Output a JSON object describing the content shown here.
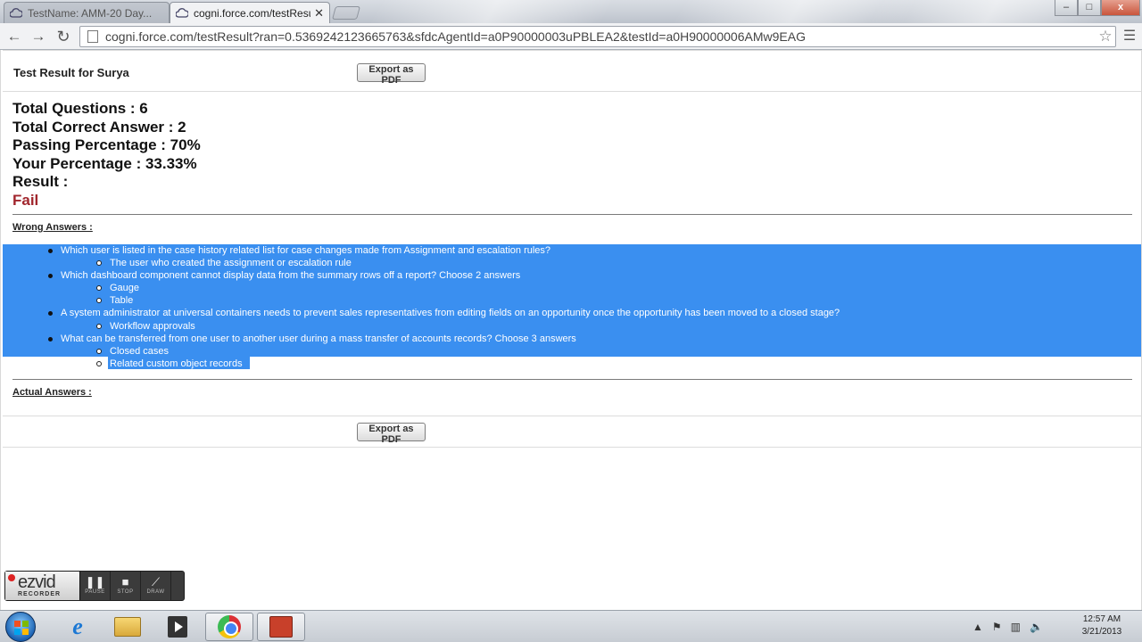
{
  "browser": {
    "tabs": [
      {
        "title": "TestName: AMM-20 Day..."
      },
      {
        "title": "cogni.force.com/testResu"
      }
    ],
    "url": "cogni.force.com/testResult?ran=0.5369242123665763&sfdcAgentId=a0P90000003uPBLEA2&testId=a0H90000006AMw9EAG"
  },
  "page": {
    "result_title": "Test Result for Surya",
    "export_label": "Export as PDF",
    "stats": {
      "total_questions": "Total Questions : 6",
      "total_correct": "Total Correct Answer : 2",
      "passing_percentage": "Passing Percentage : 70%",
      "your_percentage": "Your Percentage : 33.33%",
      "result_label": "Result :",
      "result_value": "Fail"
    },
    "colors": {
      "fail": "#a1262d",
      "selection": "#3a8ff0"
    },
    "wrong_answers_label": "Wrong Answers :",
    "actual_answers_label": "Actual Answers :",
    "wrong_answers": [
      {
        "question": "Which user is listed in the case history related list for case changes made from Assignment and escalation rules?",
        "answers": [
          "The user who created the assignment or escalation rule"
        ]
      },
      {
        "question": "Which dashboard component cannot display data from the summary rows off a report? Choose 2 answers",
        "answers": [
          "Gauge",
          "Table"
        ]
      },
      {
        "question": "A system administrator at universal containers needs to prevent sales representatives from editing fields on an opportunity once the opportunity has been moved to a closed stage?",
        "answers": [
          "Workflow approvals"
        ]
      },
      {
        "question": "What can be transferred from one user to another user during a mass transfer of accounts records? Choose 3 answers",
        "answers": [
          "Closed cases",
          "Related custom object records"
        ]
      }
    ]
  },
  "recorder": {
    "brand": "ezvid",
    "sub": "RECORDER",
    "buttons": [
      "PAUSE",
      "STOP",
      "DRAW"
    ]
  },
  "taskbar": {
    "time": "12:57 AM",
    "date": "3/21/2013"
  }
}
